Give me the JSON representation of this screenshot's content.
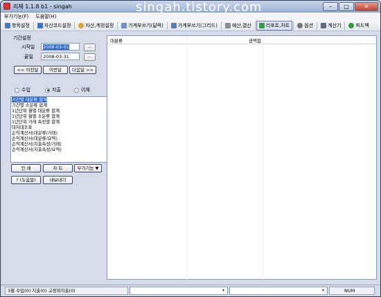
{
  "window": {
    "title": "리체 1.1.8 b1 - singah",
    "watermark": "singah.tistory.com",
    "controls": {
      "minimize": "–",
      "maximize": "□",
      "close": "✕"
    }
  },
  "menubar": {
    "items": [
      "부가기능(F)",
      "도움말(H)"
    ]
  },
  "toolbar": {
    "items": [
      {
        "label": "항목설정",
        "icon": "list-icon",
        "color": "#4a78c2"
      },
      {
        "label": "자산코드설정",
        "icon": "folder-icon",
        "color": "#3d74c9"
      },
      {
        "label": "자산,계정설정",
        "icon": "person-icon",
        "color": "#e0a22a"
      },
      {
        "label": "가계부쓰기(달력)",
        "icon": "calendar-icon",
        "color": "#6b8fc9"
      },
      {
        "label": "가계부쓰기(그리드)",
        "icon": "grid-icon",
        "color": "#5a7fb8"
      },
      {
        "label": "예산,결산",
        "icon": "budget-icon",
        "color": "#8a8f9c"
      },
      {
        "label": "리포트,차트",
        "icon": "chart-icon",
        "color": "#3a9a4a"
      },
      {
        "label": "옵션",
        "icon": "gear-icon",
        "color": "#777777"
      },
      {
        "label": "계산기",
        "icon": "calculator-icon",
        "color": "#5c6a86"
      },
      {
        "label": "피드백",
        "icon": "feedback-icon",
        "color": "#2f9a3f"
      }
    ]
  },
  "period": {
    "group_label": "기간설정",
    "start_label": "시작일",
    "start_value": "2008-03-01",
    "end_label": "끝일",
    "end_value": "2008-03-31",
    "pick_label": "...",
    "prev_month": "<< 이전달",
    "this_month": "이번달",
    "next_month": "다음달 >>"
  },
  "type_radio": {
    "options": [
      "수입",
      "지출",
      "이체"
    ],
    "selected": "지출"
  },
  "report_list": {
    "items": [
      "기간별 대분류 합계",
      "기간별 소분류 합계",
      "1년단위 월별 대분류 합계",
      "1년단위 월별 소분류 합계",
      "1년단위 거래 속성별 합계",
      "대차대조표",
      "손익계산서(대분류/거래)",
      "손익계산서(대분류/요약)",
      "손익계산서(지출속성/거래)",
      "손익계산서(지출속성/요약)"
    ],
    "selected_index": 0
  },
  "actions": {
    "print": "인 쇄",
    "chart": "차 트",
    "extra": "부가기능 ▼",
    "help": "? (도움말)",
    "export": "내보내기"
  },
  "grid": {
    "headers": [
      "대분류",
      "금액합"
    ]
  },
  "statusbar": {
    "summary": "3월 수입(0) 지출(0) 고정외지출(0)",
    "num": "NUM",
    "combo_arrow": "▾"
  }
}
